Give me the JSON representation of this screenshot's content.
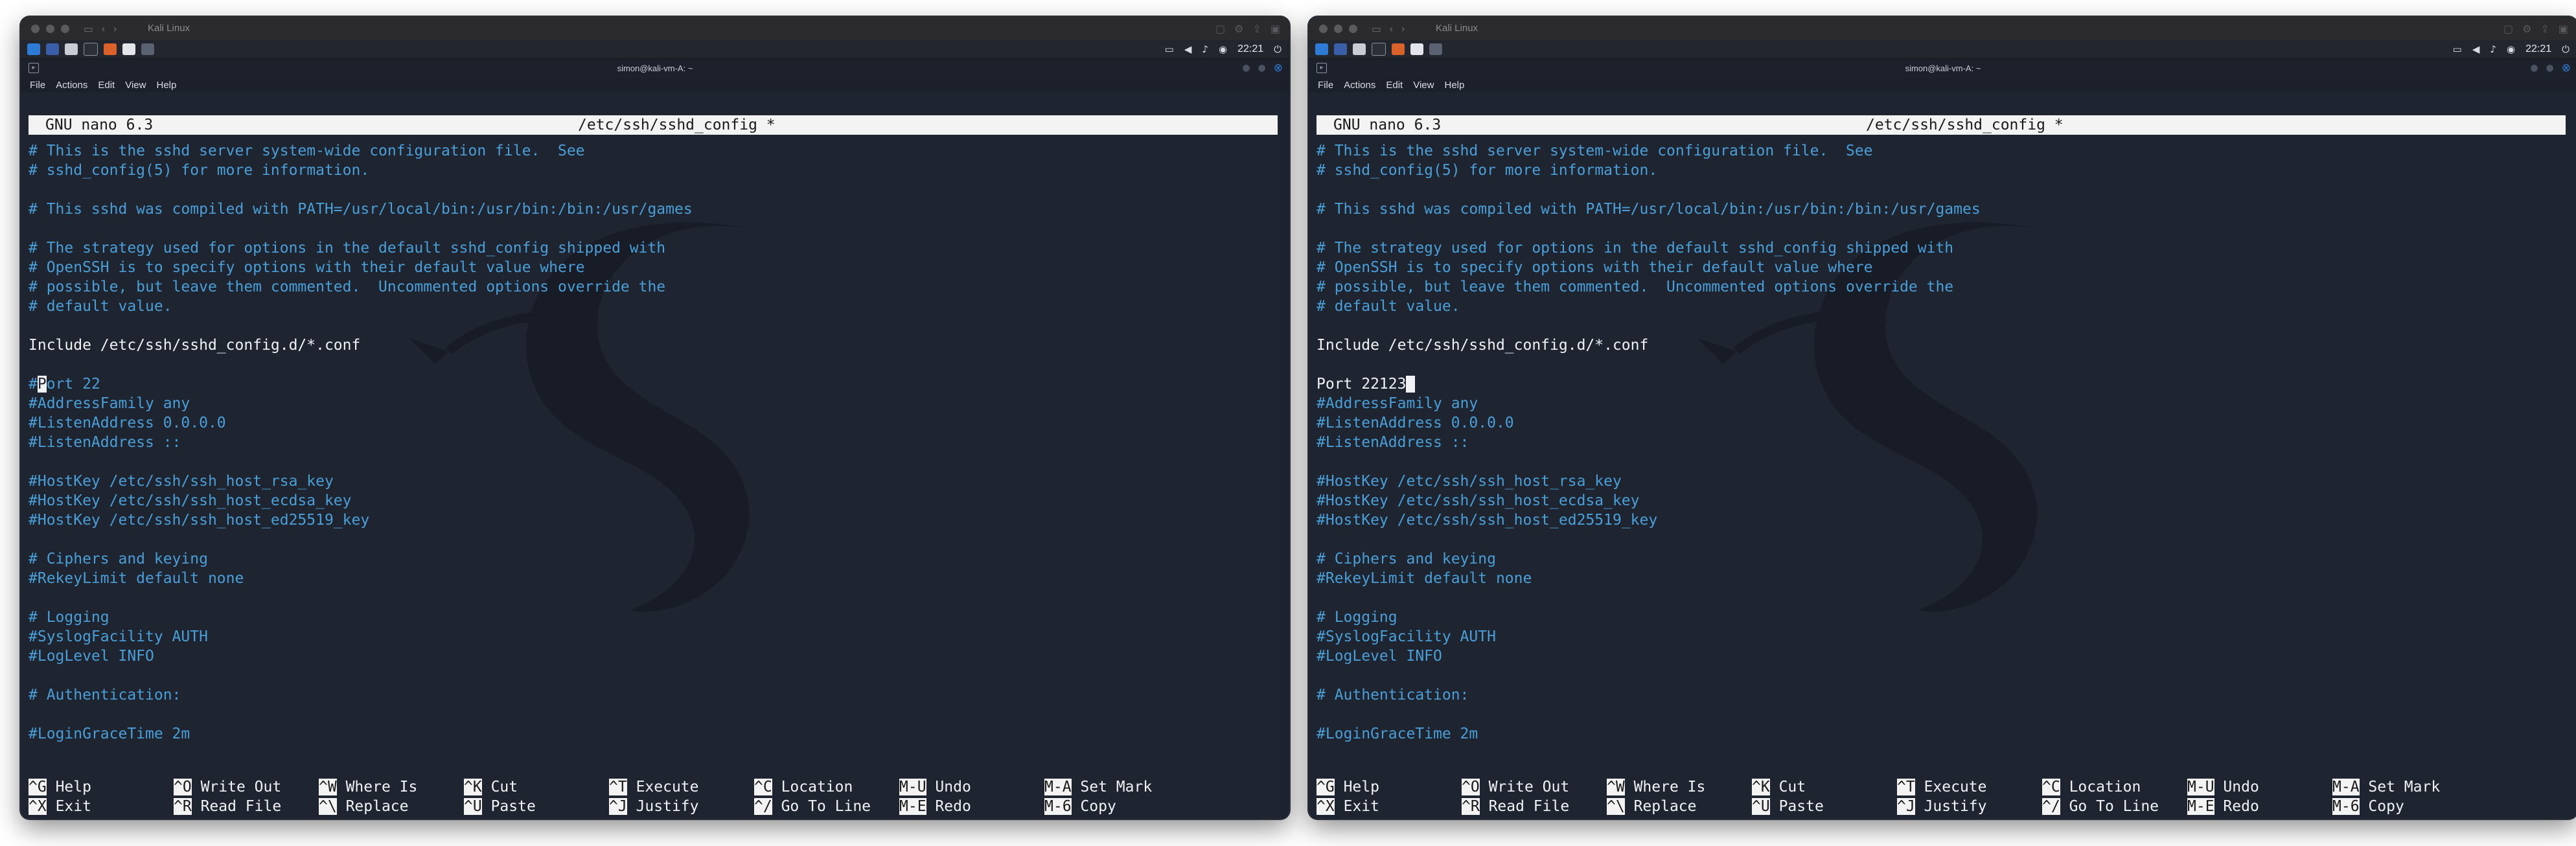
{
  "windows": [
    {
      "id": "left",
      "titlebar": {
        "title": "Kali Linux"
      },
      "panel": {
        "clock": "22:21"
      },
      "terminal": {
        "title": "simon@kali-vm-A: ~",
        "menu": [
          "File",
          "Actions",
          "Edit",
          "View",
          "Help"
        ]
      },
      "nano": {
        "version": "GNU nano 6.3",
        "file": "/etc/ssh/sshd_config *",
        "cursor_line": 12,
        "cursor_col": 1,
        "lines": [
          "# This is the sshd server system-wide configuration file.  See",
          "# sshd_config(5) for more information.",
          "",
          "# This sshd was compiled with PATH=/usr/local/bin:/usr/bin:/bin:/usr/games",
          "",
          "# The strategy used for options in the default sshd_config shipped with",
          "# OpenSSH is to specify options with their default value where",
          "# possible, but leave them commented.  Uncommented options override the",
          "# default value.",
          "",
          "Include /etc/ssh/sshd_config.d/*.conf",
          "",
          "#Port 22",
          "#AddressFamily any",
          "#ListenAddress 0.0.0.0",
          "#ListenAddress ::",
          "",
          "#HostKey /etc/ssh/ssh_host_rsa_key",
          "#HostKey /etc/ssh/ssh_host_ecdsa_key",
          "#HostKey /etc/ssh/ssh_host_ed25519_key",
          "",
          "# Ciphers and keying",
          "#RekeyLimit default none",
          "",
          "# Logging",
          "#SyslogFacility AUTH",
          "#LogLevel INFO",
          "",
          "# Authentication:",
          "",
          "#LoginGraceTime 2m"
        ],
        "shortcuts": [
          [
            [
              "^G",
              "Help"
            ],
            [
              "^O",
              "Write Out"
            ],
            [
              "^W",
              "Where Is"
            ],
            [
              "^K",
              "Cut"
            ],
            [
              "^T",
              "Execute"
            ],
            [
              "^C",
              "Location"
            ],
            [
              "M-U",
              "Undo"
            ],
            [
              "M-A",
              "Set Mark"
            ]
          ],
          [
            [
              "^X",
              "Exit"
            ],
            [
              "^R",
              "Read File"
            ],
            [
              "^\\",
              "Replace"
            ],
            [
              "^U",
              "Paste"
            ],
            [
              "^J",
              "Justify"
            ],
            [
              "^/",
              "Go To Line"
            ],
            [
              "M-E",
              "Redo"
            ],
            [
              "M-6",
              "Copy"
            ]
          ]
        ]
      }
    },
    {
      "id": "right",
      "titlebar": {
        "title": "Kali Linux"
      },
      "panel": {
        "clock": "22:21"
      },
      "terminal": {
        "title": "simon@kali-vm-A: ~",
        "menu": [
          "File",
          "Actions",
          "Edit",
          "View",
          "Help"
        ]
      },
      "nano": {
        "version": "GNU nano 6.3",
        "file": "/etc/ssh/sshd_config *",
        "cursor_line": 12,
        "cursor_col": 10,
        "lines": [
          "# This is the sshd server system-wide configuration file.  See",
          "# sshd_config(5) for more information.",
          "",
          "# This sshd was compiled with PATH=/usr/local/bin:/usr/bin:/bin:/usr/games",
          "",
          "# The strategy used for options in the default sshd_config shipped with",
          "# OpenSSH is to specify options with their default value where",
          "# possible, but leave them commented.  Uncommented options override the",
          "# default value.",
          "",
          "Include /etc/ssh/sshd_config.d/*.conf",
          "",
          "Port 22123",
          "#AddressFamily any",
          "#ListenAddress 0.0.0.0",
          "#ListenAddress ::",
          "",
          "#HostKey /etc/ssh/ssh_host_rsa_key",
          "#HostKey /etc/ssh/ssh_host_ecdsa_key",
          "#HostKey /etc/ssh/ssh_host_ed25519_key",
          "",
          "# Ciphers and keying",
          "#RekeyLimit default none",
          "",
          "# Logging",
          "#SyslogFacility AUTH",
          "#LogLevel INFO",
          "",
          "# Authentication:",
          "",
          "#LoginGraceTime 2m"
        ],
        "shortcuts": [
          [
            [
              "^G",
              "Help"
            ],
            [
              "^O",
              "Write Out"
            ],
            [
              "^W",
              "Where Is"
            ],
            [
              "^K",
              "Cut"
            ],
            [
              "^T",
              "Execute"
            ],
            [
              "^C",
              "Location"
            ],
            [
              "M-U",
              "Undo"
            ],
            [
              "M-A",
              "Set Mark"
            ]
          ],
          [
            [
              "^X",
              "Exit"
            ],
            [
              "^R",
              "Read File"
            ],
            [
              "^\\",
              "Replace"
            ],
            [
              "^U",
              "Paste"
            ],
            [
              "^J",
              "Justify"
            ],
            [
              "^/",
              "Go To Line"
            ],
            [
              "M-E",
              "Redo"
            ],
            [
              "M-6",
              "Copy"
            ]
          ]
        ]
      }
    }
  ],
  "colors": {
    "comment": "#4a9fd8",
    "text": "#f0f2f6",
    "terminal_bg": "#1e2430",
    "header_bg": "#f3f3f3",
    "close_button": "#2e7bd6"
  },
  "icons": {
    "titlebar": [
      "sidebar-icon",
      "back-icon",
      "forward-icon",
      "lock-icon"
    ],
    "panel": [
      "kali-menu-icon",
      "workspace-icon",
      "files-icon",
      "terminal-icon",
      "firefox-icon",
      "editor-icon",
      "screen-icon",
      "network-icon",
      "volume-icon",
      "bell-icon",
      "power-icon"
    ],
    "window_controls": [
      "minimize-icon",
      "maximize-icon",
      "close-icon"
    ]
  }
}
